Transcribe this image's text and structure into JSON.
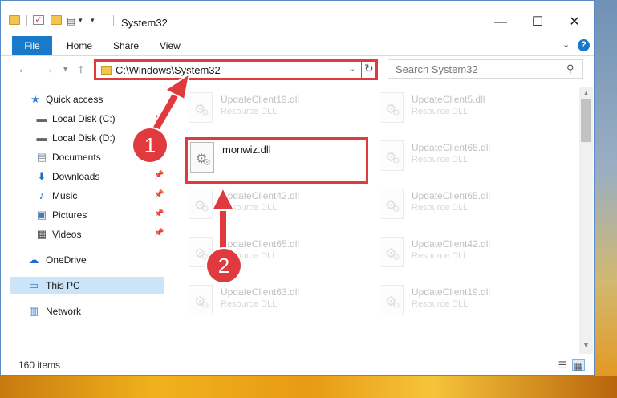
{
  "window": {
    "title": "System32",
    "controls": {
      "minimize": "—",
      "maximize": "☐",
      "close": "✕"
    }
  },
  "ribbon": {
    "tabs": [
      "File",
      "Home",
      "Share",
      "View"
    ],
    "help": "?"
  },
  "navigation": {
    "address": "C:\\Windows\\System32",
    "search_placeholder": "Search System32"
  },
  "sidebar": {
    "items": [
      {
        "label": "Quick access",
        "icon": "star-icon",
        "pinned": false
      },
      {
        "label": "Local Disk (C:)",
        "icon": "drive-icon",
        "pinned": true
      },
      {
        "label": "Local Disk (D:)",
        "icon": "drive-icon",
        "pinned": true
      },
      {
        "label": "Documents",
        "icon": "documents-icon",
        "pinned": true
      },
      {
        "label": "Downloads",
        "icon": "download-icon",
        "pinned": true
      },
      {
        "label": "Music",
        "icon": "music-icon",
        "pinned": true
      },
      {
        "label": "Pictures",
        "icon": "pictures-icon",
        "pinned": true
      },
      {
        "label": "Videos",
        "icon": "video-icon",
        "pinned": true
      },
      {
        "label": "OneDrive",
        "icon": "cloud-icon",
        "pinned": false
      },
      {
        "label": "This PC",
        "icon": "computer-icon",
        "pinned": false,
        "selected": true
      },
      {
        "label": "Network",
        "icon": "network-icon",
        "pinned": false
      }
    ]
  },
  "files": {
    "highlighted": {
      "name": "monwiz.dll"
    },
    "background": [
      {
        "name": "UpdateClient19.dll",
        "type": "Resource DLL"
      },
      {
        "name": "UpdateClient5.dll",
        "type": "Resource DLL"
      },
      {
        "name": "UpdateClient65.dll",
        "type": "Resource DLL"
      },
      {
        "name": "UpdateClient42.dll",
        "type": "Resource DLL"
      },
      {
        "name": "UpdateClient65.dll",
        "type": "Resource DLL"
      },
      {
        "name": "UpdateClient65.dll",
        "type": "Resource DLL"
      },
      {
        "name": "UpdateClient42.dll",
        "type": "Resource DLL"
      },
      {
        "name": "UpdateClient63.dll",
        "type": "Resource DLL"
      },
      {
        "name": "UpdateClient19.dll",
        "type": "Resource DLL"
      }
    ]
  },
  "status": {
    "count": "160 items"
  },
  "callouts": {
    "step1": "1",
    "step2": "2"
  },
  "colors": {
    "accent": "#1979ca",
    "annotation": "#e0393e",
    "selection": "#cce4f7"
  }
}
